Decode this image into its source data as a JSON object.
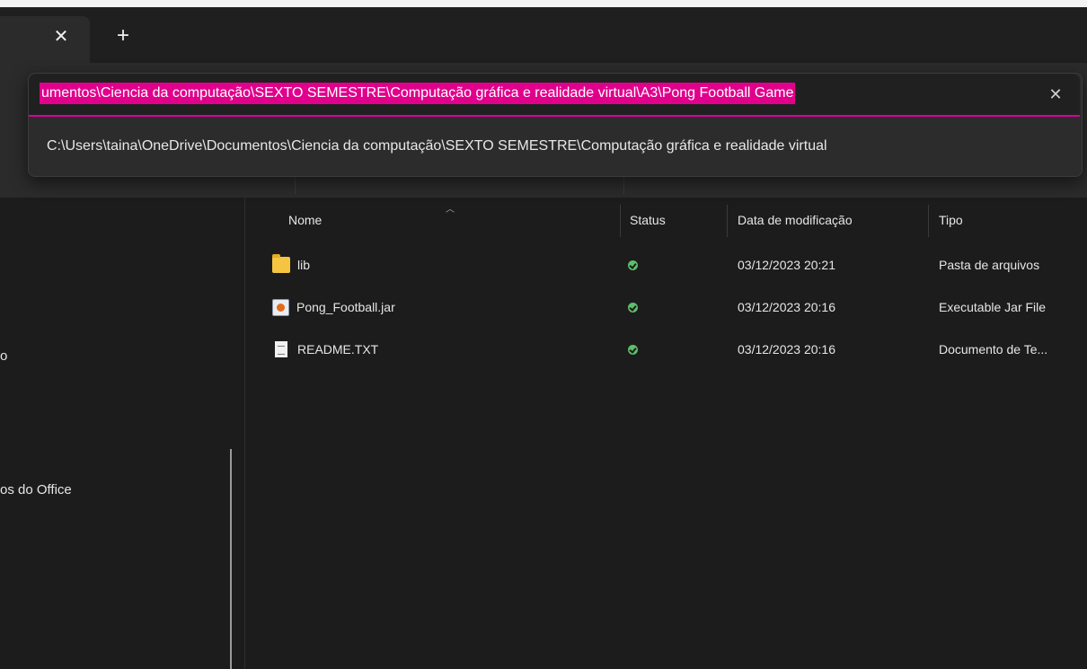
{
  "address": {
    "value": "umentos\\Ciencia da computação\\SEXTO SEMESTRE\\Computação gráfica e realidade virtual\\A3\\Pong Football Game",
    "suggestion": "C:\\Users\\taina\\OneDrive\\Documentos\\Ciencia da computação\\SEXTO SEMESTRE\\Computação gráfica e realidade virtual"
  },
  "tabs": {
    "close_glyph": "✕",
    "new_glyph": "+"
  },
  "sidebar": {
    "items": [
      {
        "label": "o"
      },
      {
        "label": "os do Office"
      }
    ]
  },
  "columns": {
    "name": "Nome",
    "status": "Status",
    "modified": "Data de modificação",
    "type": "Tipo"
  },
  "files": [
    {
      "name": "lib",
      "icon": "folder-icon",
      "modified": "03/12/2023 20:21",
      "type": "Pasta de arquivos"
    },
    {
      "name": "Pong_Football.jar",
      "icon": "jar-file-icon",
      "modified": "03/12/2023 20:16",
      "type": "Executable Jar File"
    },
    {
      "name": "README.TXT",
      "icon": "text-file-icon",
      "modified": "03/12/2023 20:16",
      "type": "Documento de Te..."
    }
  ],
  "colors": {
    "accent": "#e0008c",
    "status_ok": "#5cbf6a"
  }
}
